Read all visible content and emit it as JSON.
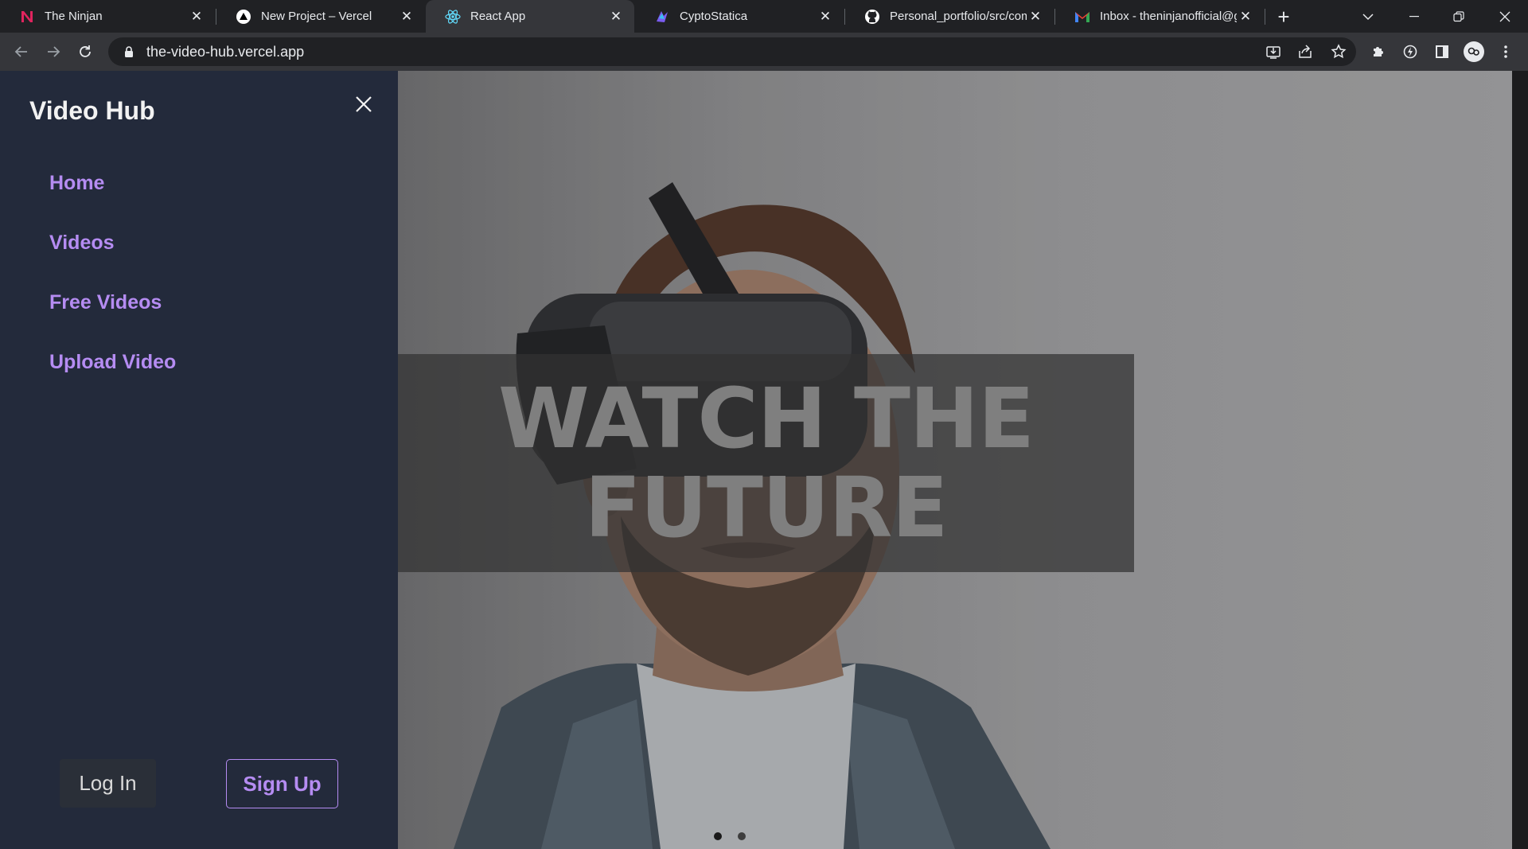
{
  "browser": {
    "tabs": [
      {
        "title": "The Ninjan",
        "icon": "ninjan-n-icon",
        "active": false
      },
      {
        "title": "New Project – Vercel",
        "icon": "vercel-triangle-icon",
        "active": false
      },
      {
        "title": "React App",
        "icon": "react-atom-icon",
        "active": true
      },
      {
        "title": "CyptoStatica",
        "icon": "cyptostatica-icon",
        "active": false
      },
      {
        "title": "Personal_portfolio/src/com",
        "icon": "github-icon",
        "active": false
      },
      {
        "title": "Inbox - theninjanofficial@g",
        "icon": "gmail-icon",
        "active": false
      }
    ],
    "url": "the-video-hub.vercel.app"
  },
  "sidebar": {
    "brand": "Video Hub",
    "items": [
      {
        "label": "Home"
      },
      {
        "label": "Videos"
      },
      {
        "label": "Free Videos"
      },
      {
        "label": "Upload Video"
      }
    ],
    "login_label": "Log In",
    "signup_label": "Sign Up"
  },
  "hero": {
    "headline_line1": "WATCH THE",
    "headline_line2": "FUTURE",
    "slides_total": 2,
    "active_slide": 1
  },
  "colors": {
    "sidebar_bg": "#232a3b",
    "accent_purple": "#b58cf2",
    "chrome_dark": "#202124",
    "chrome_toolbar": "#35363a"
  }
}
